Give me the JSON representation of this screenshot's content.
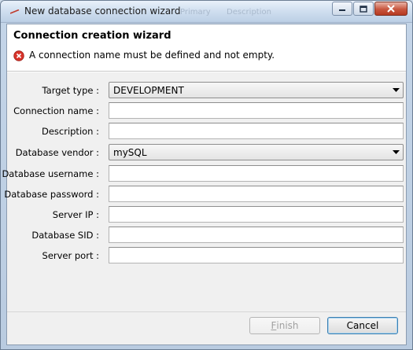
{
  "window": {
    "title": "New database connection wizard",
    "ghost_titles": [
      "Primary",
      "Description"
    ]
  },
  "wizard": {
    "title": "Connection creation wizard",
    "error_message": "A connection name must be defined and not empty."
  },
  "form": {
    "target_type": {
      "label": "Target type :",
      "value": "DEVELOPMENT"
    },
    "connection_name": {
      "label": "Connection name :",
      "value": ""
    },
    "description": {
      "label": "Description :",
      "value": ""
    },
    "database_vendor": {
      "label": "Database vendor :",
      "value": "mySQL"
    },
    "database_username": {
      "label": "Database username :",
      "value": ""
    },
    "database_password": {
      "label": "Database password :",
      "value": ""
    },
    "server_ip": {
      "label": "Server IP :",
      "value": ""
    },
    "database_sid": {
      "label": "Database SID :",
      "value": ""
    },
    "server_port": {
      "label": "Server port :",
      "value": ""
    }
  },
  "buttons": {
    "finish_first": "F",
    "finish_rest": "inish",
    "cancel": "Cancel"
  },
  "icons": {
    "app": "wizard-app-icon",
    "error": "error-circle-icon",
    "minimize": "minimize-icon",
    "maximize": "maximize-icon",
    "close": "close-icon",
    "dropdown": "chevron-down-icon"
  },
  "colors": {
    "error_red": "#d9342b",
    "title_bar": "#cfdeef",
    "form_bg": "#f0f0f0"
  }
}
